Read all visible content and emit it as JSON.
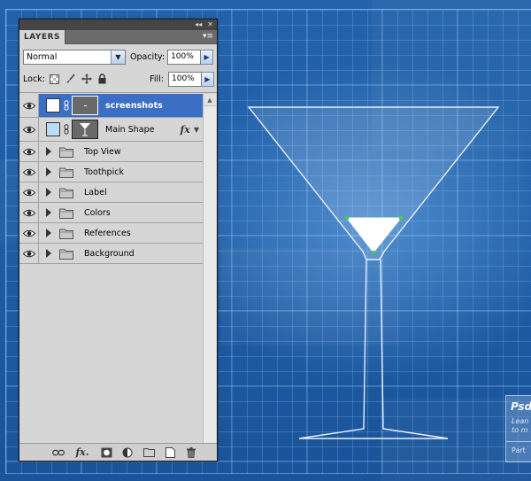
{
  "panel": {
    "title": "LAYERS",
    "blend_mode": "Normal",
    "opacity_label": "Opacity:",
    "opacity_value": "100%",
    "lock_label": "Lock:",
    "fill_label": "Fill:",
    "fill_value": "100%"
  },
  "layers": [
    {
      "name": "screenshots",
      "selected": true,
      "type": "layer-white"
    },
    {
      "name": "Main Shape",
      "selected": false,
      "type": "shape-fx"
    },
    {
      "name": "Top View",
      "type": "group"
    },
    {
      "name": "Toothpick",
      "type": "group"
    },
    {
      "name": "Label",
      "type": "group"
    },
    {
      "name": "Colors",
      "type": "group"
    },
    {
      "name": "References",
      "type": "group"
    },
    {
      "name": "Background",
      "type": "group"
    }
  ],
  "psd_box": {
    "title": "Psd",
    "line1": "Lean",
    "line2": "to m",
    "line3": "Part"
  },
  "colors": {
    "canvas_blue": "#1d5ca4",
    "selection_blue": "#3a6fc4",
    "panel_gray": "#d6d6d6",
    "anchor_green": "#3fcf3f"
  }
}
